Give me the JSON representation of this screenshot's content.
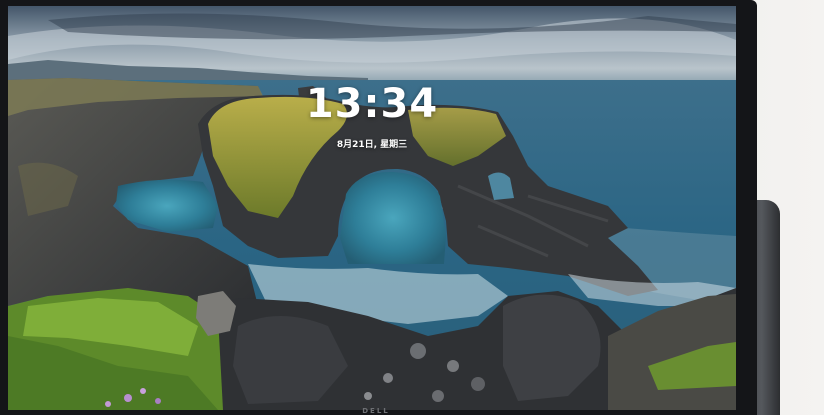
{
  "lock_screen": {
    "time": "13:34",
    "date": "8月21日, 星期三"
  },
  "monitor": {
    "brand_logo": "DELL"
  },
  "colors": {
    "sky": "#5f7688",
    "sea": "#2f6786",
    "lagoon": "#3a8fa8",
    "moss": "#a7a23d",
    "rock": "#3b3d40",
    "grass": "#6f9a2e"
  }
}
